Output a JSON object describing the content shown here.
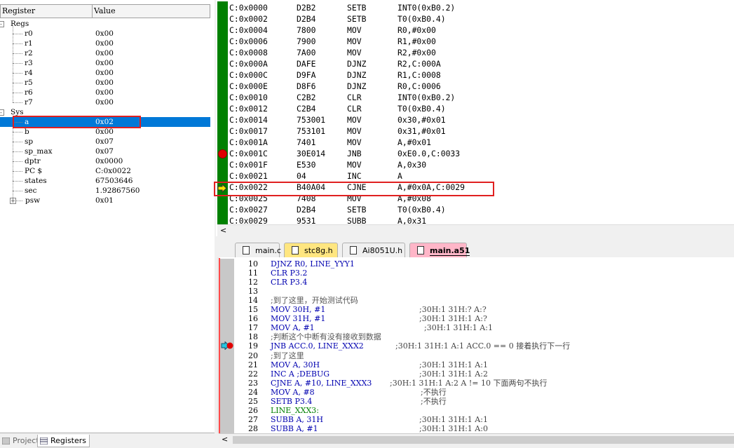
{
  "registers": {
    "columns": {
      "name": "Register",
      "value": "Value"
    },
    "groups": [
      {
        "label": "Regs",
        "items": [
          {
            "name": "r0",
            "value": "0x00"
          },
          {
            "name": "r1",
            "value": "0x00"
          },
          {
            "name": "r2",
            "value": "0x00"
          },
          {
            "name": "r3",
            "value": "0x00"
          },
          {
            "name": "r4",
            "value": "0x00"
          },
          {
            "name": "r5",
            "value": "0x00"
          },
          {
            "name": "r6",
            "value": "0x00"
          },
          {
            "name": "r7",
            "value": "0x00"
          }
        ]
      },
      {
        "label": "Sys",
        "items": [
          {
            "name": "a",
            "value": "0x02"
          },
          {
            "name": "b",
            "value": "0x00"
          },
          {
            "name": "sp",
            "value": "0x07"
          },
          {
            "name": "sp_max",
            "value": "0x07"
          },
          {
            "name": "dptr",
            "value": "0x0000"
          },
          {
            "name": "PC  $",
            "value": "C:0x0022"
          },
          {
            "name": "states",
            "value": "67503646"
          },
          {
            "name": "sec",
            "value": "1.92867560"
          },
          {
            "name": "psw",
            "value": "0x01"
          }
        ]
      }
    ],
    "selected_register": "a"
  },
  "bottom_tabs": [
    {
      "label": "Project",
      "active": false
    },
    {
      "label": "Registers",
      "active": true
    }
  ],
  "disassembly": {
    "rows": [
      {
        "addr": "C:0x0000",
        "bytes": "D2B2",
        "op": "SETB",
        "args": "INT0(0xB0.2)"
      },
      {
        "addr": "C:0x0002",
        "bytes": "D2B4",
        "op": "SETB",
        "args": "T0(0xB0.4)"
      },
      {
        "addr": "C:0x0004",
        "bytes": "7800",
        "op": "MOV",
        "args": "R0,#0x00"
      },
      {
        "addr": "C:0x0006",
        "bytes": "7900",
        "op": "MOV",
        "args": "R1,#0x00"
      },
      {
        "addr": "C:0x0008",
        "bytes": "7A00",
        "op": "MOV",
        "args": "R2,#0x00"
      },
      {
        "addr": "C:0x000A",
        "bytes": "DAFE",
        "op": "DJNZ",
        "args": "R2,C:000A"
      },
      {
        "addr": "C:0x000C",
        "bytes": "D9FA",
        "op": "DJNZ",
        "args": "R1,C:0008"
      },
      {
        "addr": "C:0x000E",
        "bytes": "D8F6",
        "op": "DJNZ",
        "args": "R0,C:0006"
      },
      {
        "addr": "C:0x0010",
        "bytes": "C2B2",
        "op": "CLR",
        "args": "INT0(0xB0.2)"
      },
      {
        "addr": "C:0x0012",
        "bytes": "C2B4",
        "op": "CLR",
        "args": "T0(0xB0.4)"
      },
      {
        "addr": "C:0x0014",
        "bytes": "753001",
        "op": "MOV",
        "args": "0x30,#0x01"
      },
      {
        "addr": "C:0x0017",
        "bytes": "753101",
        "op": "MOV",
        "args": "0x31,#0x01"
      },
      {
        "addr": "C:0x001A",
        "bytes": "7401",
        "op": "MOV",
        "args": "A,#0x01"
      },
      {
        "addr": "C:0x001C",
        "bytes": "30E014",
        "op": "JNB",
        "args": "0xE0.0,C:0033"
      },
      {
        "addr": "C:0x001F",
        "bytes": "E530",
        "op": "MOV",
        "args": "A,0x30"
      },
      {
        "addr": "C:0x0021",
        "bytes": "04",
        "op": "INC",
        "args": "A"
      },
      {
        "addr": "C:0x0022",
        "bytes": "B40A04",
        "op": "CJNE",
        "args": "A,#0x0A,C:0029"
      },
      {
        "addr": "C:0x0025",
        "bytes": "7408",
        "op": "MOV",
        "args": "A,#0x08"
      },
      {
        "addr": "C:0x0027",
        "bytes": "D2B4",
        "op": "SETB",
        "args": "T0(0xB0.4)"
      },
      {
        "addr": "C:0x0029",
        "bytes": "9531",
        "op": "SUBB",
        "args": "A,0x31"
      }
    ],
    "breakpoint_addr": "C:0x001C",
    "current_addr": "C:0x0022",
    "scroll_left_glyph": "<"
  },
  "editor_tabs": [
    {
      "label": "main.c",
      "color": "#f0f0f0",
      "active": false
    },
    {
      "label": "stc8g.h",
      "color": "#ffe680",
      "active": false
    },
    {
      "label": "Ai8051U.h",
      "color": "#f0f0f0",
      "active": false
    },
    {
      "label": "main.a51",
      "color": "#ffb6c8",
      "active": true
    }
  ],
  "source": {
    "lines": [
      {
        "n": "10",
        "code": "DJNZ R0, LINE_YYY1",
        "cmt": ""
      },
      {
        "n": "11",
        "code": "CLR P3.2",
        "cmt": ""
      },
      {
        "n": "12",
        "code": "CLR P3.4",
        "cmt": ""
      },
      {
        "n": "13",
        "code": "",
        "cmt": ""
      },
      {
        "n": "14",
        "code": ";到了这里，开始测试代码",
        "cmt": ""
      },
      {
        "n": "15",
        "code": "MOV 30H, #1",
        "cmt": ";30H:1 31H:? A:?"
      },
      {
        "n": "16",
        "code": "MOV 31H, #1",
        "cmt": ";30H:1 31H:1 A:?"
      },
      {
        "n": "17",
        "code": "MOV A, #1",
        "cmt": ";30H:1 31H:1 A:1"
      },
      {
        "n": "18",
        "code": ";判断这个中断有没有接收到数据",
        "cmt": ""
      },
      {
        "n": "19",
        "code": "JNB ACC.0, LINE_XXX2",
        "cmt": ";30H:1 31H:1 A:1          ACC.0 == 0 接着执行下一行"
      },
      {
        "n": "20",
        "code": ";到了这里",
        "cmt": ""
      },
      {
        "n": "21",
        "code": "MOV A, 30H",
        "cmt": ";30H:1 31H:1 A:1"
      },
      {
        "n": "22",
        "code": "INC A ;DEBUG",
        "cmt": ";30H:1 31H:1 A:2"
      },
      {
        "n": "23",
        "code": "CJNE A, #10, LINE_XXX3",
        "cmt": ";30H:1 31H:1 A:2      A != 10 下面两句不执行"
      },
      {
        "n": "24",
        "code": "MOV A, #8",
        "cmt": ";不执行"
      },
      {
        "n": "25",
        "code": "SETB P3.4",
        "cmt": ";不执行"
      },
      {
        "n": "26",
        "code": "LINE_XXX3:",
        "cmt": ""
      },
      {
        "n": "27",
        "code": "SUBB A, 31H",
        "cmt": ";30H:1 31H:1 A:1"
      },
      {
        "n": "28",
        "code": "SUBB A, #1",
        "cmt": ";30H:1 31H:1 A:0"
      }
    ],
    "breakpoint_line": "19",
    "scroll_left_glyph": "<"
  }
}
